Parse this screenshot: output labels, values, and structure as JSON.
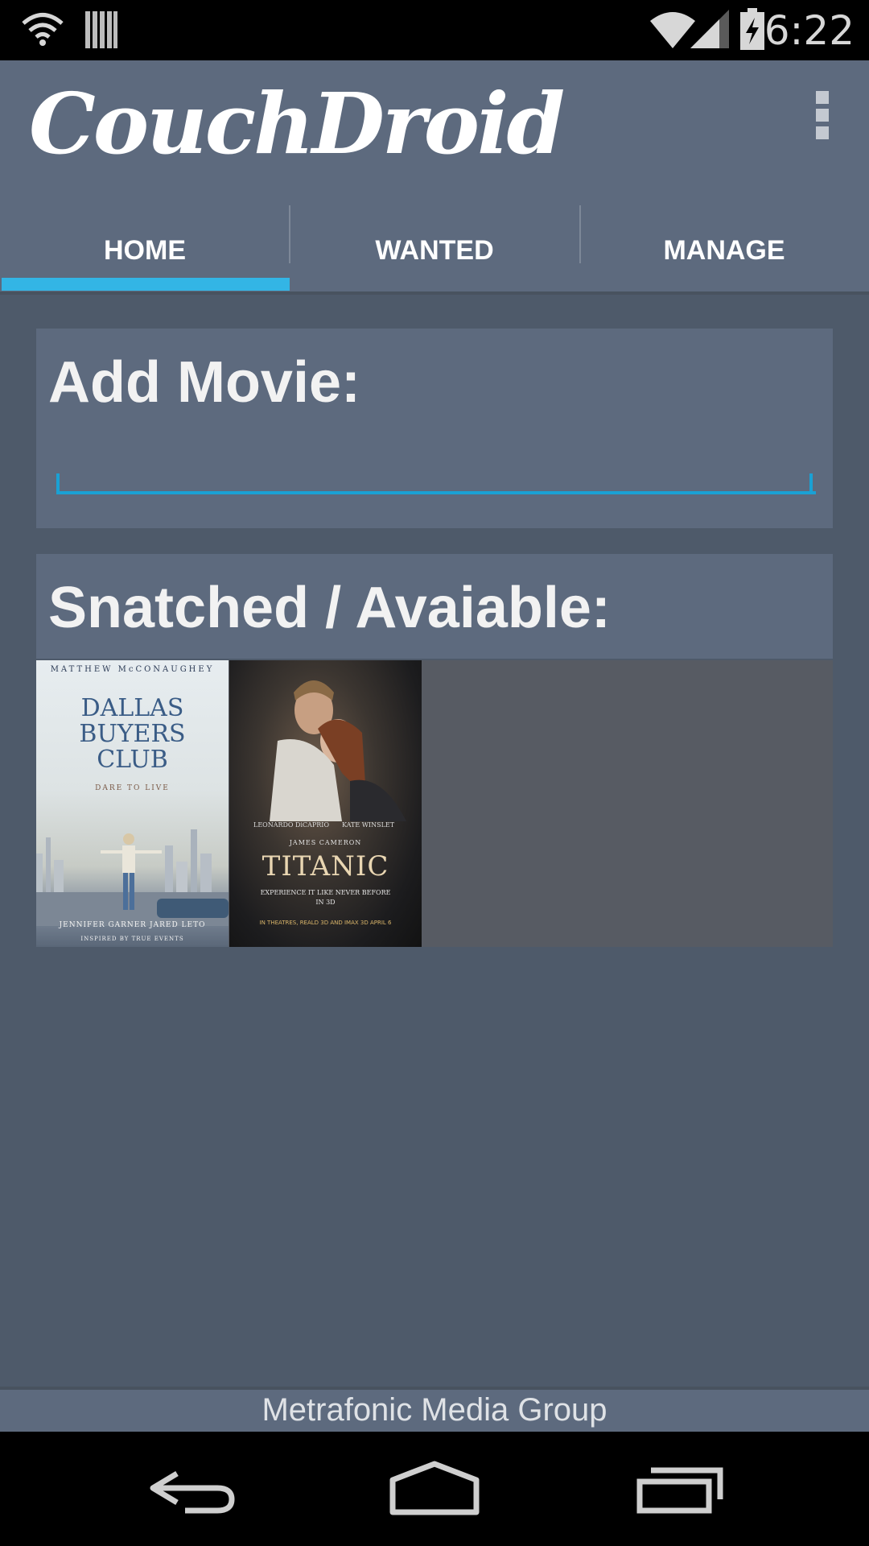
{
  "status_bar": {
    "time": "6:22",
    "icons": [
      "wifi-icon",
      "notification-barcode-icon",
      "wifi-signal-icon",
      "cell-signal-icon",
      "battery-charging-icon"
    ]
  },
  "app": {
    "title": "CouchDroid"
  },
  "tabs": [
    {
      "label": "HOME",
      "selected": true
    },
    {
      "label": "WANTED",
      "selected": false
    },
    {
      "label": "MANAGE",
      "selected": false
    }
  ],
  "add_movie": {
    "title": "Add Movie:",
    "input_value": ""
  },
  "snatched": {
    "title": "Snatched / Avaiable:",
    "posters": [
      {
        "top_text": "MATTHEW McCONAUGHEY",
        "title_line1": "DALLAS",
        "title_line2": "BUYERS",
        "title_line3": "CLUB",
        "tagline": "DARE TO LIVE",
        "credits": "JENNIFER GARNER   JARED LETO",
        "footer": "INSPIRED BY TRUE EVENTS"
      },
      {
        "actor_left": "LEONARDO DiCAPRIO",
        "actor_right": "KATE WINSLET",
        "director": "JAMES CAMERON",
        "title": "TITANIC",
        "tagline_line1": "EXPERIENCE IT LIKE NEVER BEFORE",
        "tagline_line2": "IN 3D",
        "release": "IN THEATRES, REALD 3D AND IMAX 3D APRIL 6"
      }
    ]
  },
  "footer": {
    "text": "Metrafonic Media Group"
  },
  "nav_bar": {
    "buttons": [
      "back-icon",
      "home-icon",
      "recent-apps-icon"
    ]
  },
  "colors": {
    "accent": "#33b5e5",
    "action_bar": "#5d6a7e",
    "background": "#4e5a6a"
  }
}
